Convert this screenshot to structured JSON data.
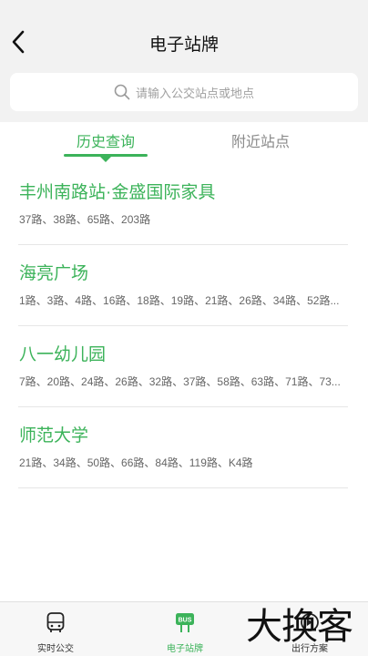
{
  "header": {
    "title": "电子站牌",
    "search_placeholder": "请输入公交站点或地点"
  },
  "tabs": {
    "history": "历史查询",
    "nearby": "附近站点",
    "active": "history"
  },
  "stations": [
    {
      "name": "丰州南路站·金盛国际家具",
      "routes": "37路、38路、65路、203路"
    },
    {
      "name": "海亮广场",
      "routes": "1路、3路、4路、16路、18路、19路、21路、26路、34路、52路..."
    },
    {
      "name": "八一幼儿园",
      "routes": "7路、20路、24路、26路、32路、37路、58路、63路、71路、73..."
    },
    {
      "name": "师范大学",
      "routes": "21路、34路、50路、66路、84路、119路、K4路"
    }
  ],
  "tabbar": {
    "items": [
      {
        "label": "实时公交",
        "icon": "bus-front-icon"
      },
      {
        "label": "电子站牌",
        "icon": "bus-stop-sign-icon",
        "badge": "BUS"
      },
      {
        "label": "出行方案",
        "icon": "route-plan-icon"
      }
    ],
    "active_index": 1
  },
  "watermark": "大换客",
  "colors": {
    "accent": "#3cb35a",
    "header_bg": "#f2f2f2",
    "muted_text": "#8a8a8a",
    "divider": "#e6e6e6"
  }
}
